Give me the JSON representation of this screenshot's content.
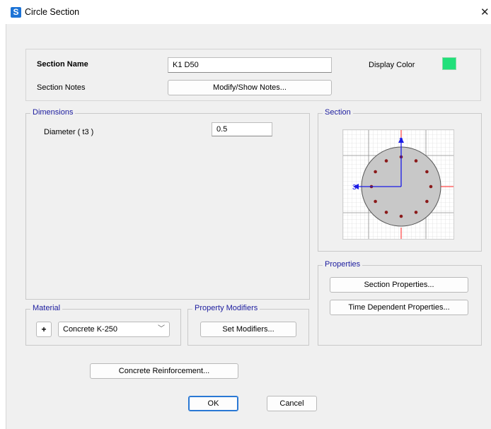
{
  "window": {
    "app_icon_letter": "S",
    "title": "Circle Section"
  },
  "section": {
    "name_label": "Section Name",
    "name_value": "K1 D50",
    "notes_label": "Section Notes",
    "notes_button": "Modify/Show Notes...",
    "display_color_label": "Display Color",
    "display_color": "#21e07a"
  },
  "dimensions": {
    "title": "Dimensions",
    "diameter_label": "Diameter  ( t3 )",
    "diameter_value": "0.5"
  },
  "section_preview": {
    "title": "Section",
    "axis_2_label": "2",
    "axis_3_label": "3",
    "bar_count": 12,
    "colors": {
      "fill": "#c8c8c8",
      "bar": "#8b1a1a",
      "axis": "#1a1ae6",
      "ref_line": "#ff1a1a"
    }
  },
  "properties": {
    "title": "Properties",
    "section_properties_button": "Section Properties...",
    "time_dependent_button": "Time Dependent Properties..."
  },
  "material": {
    "title": "Material",
    "add_label": "+",
    "selected": "Concrete K-250"
  },
  "property_modifiers": {
    "title": "Property Modifiers",
    "set_modifiers_button": "Set Modifiers..."
  },
  "footer": {
    "concrete_reinforcement_button": "Concrete Reinforcement...",
    "ok_button": "OK",
    "cancel_button": "Cancel"
  }
}
